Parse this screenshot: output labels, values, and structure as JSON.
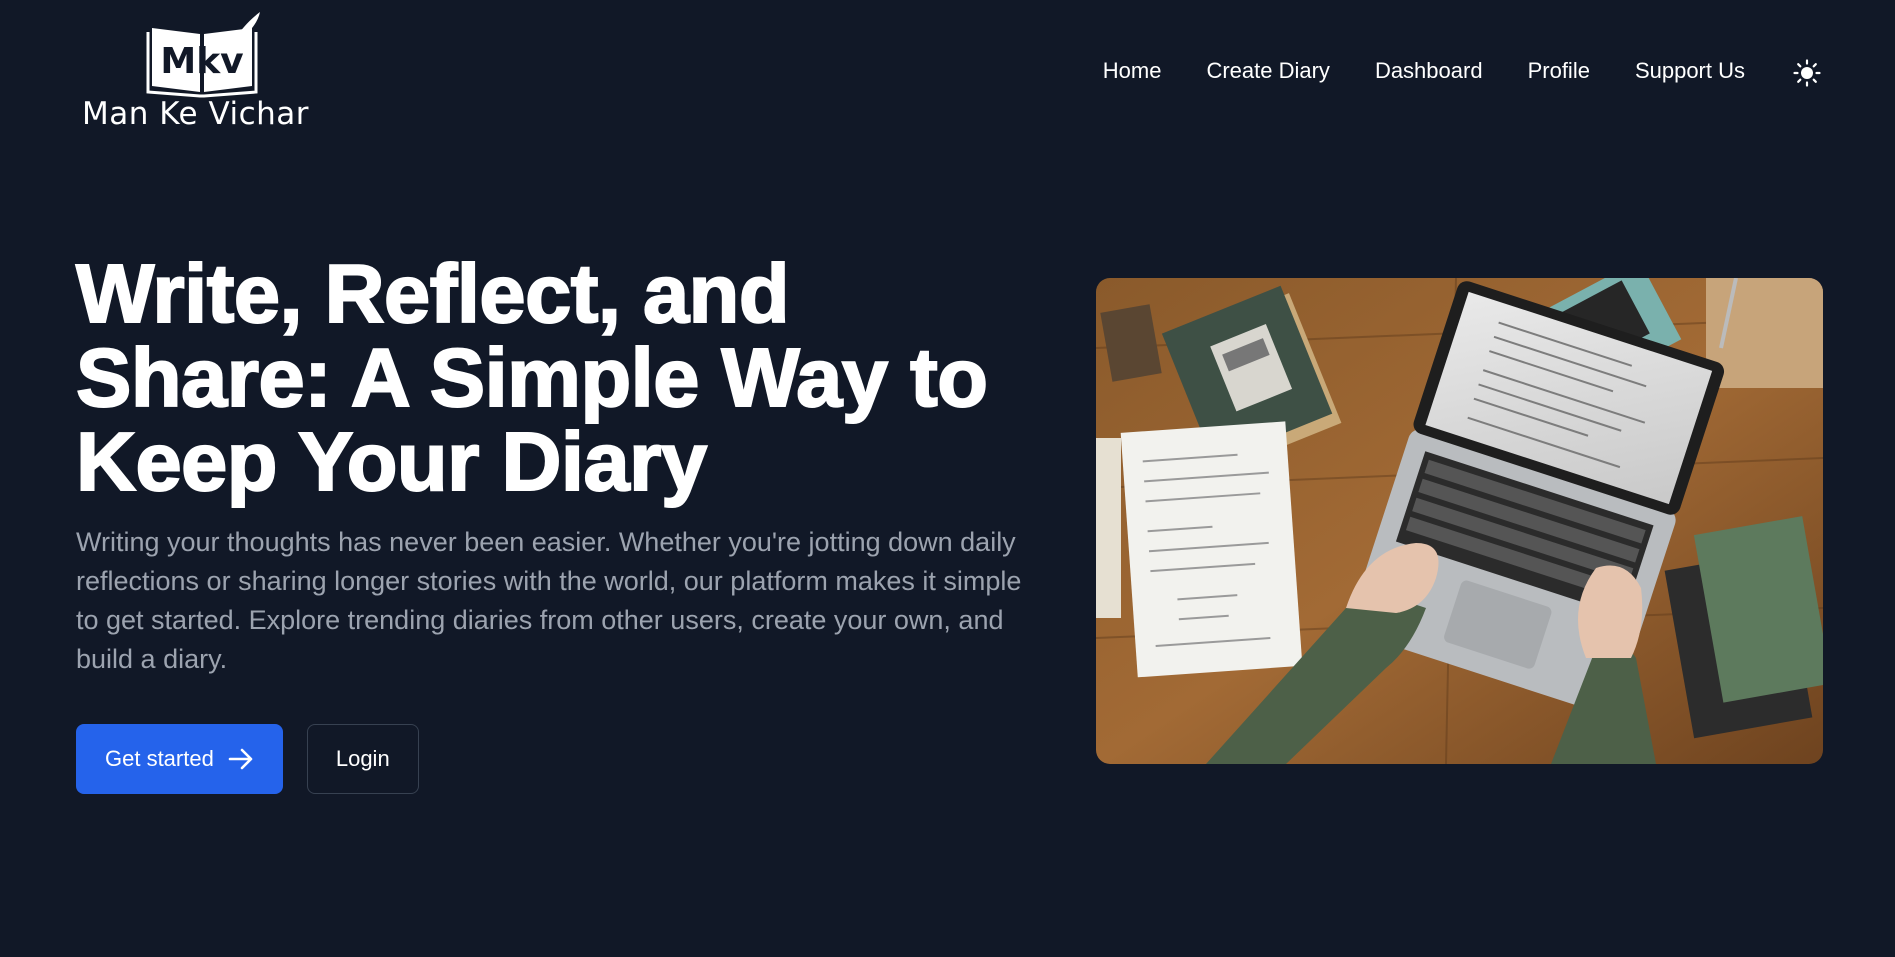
{
  "brand": {
    "logo_initials": "Mkv",
    "name": "Man Ke Vichar",
    "icon": "book-quill-logo-icon"
  },
  "nav": {
    "items": [
      {
        "label": "Home"
      },
      {
        "label": "Create Diary"
      },
      {
        "label": "Dashboard"
      },
      {
        "label": "Profile"
      },
      {
        "label": "Support Us"
      }
    ],
    "theme_toggle_icon": "sun-icon"
  },
  "hero": {
    "title": "Write, Reflect, and Share: A Simple Way to Keep Your Diary",
    "description": "Writing your thoughts has never been easier. Whether you're jotting down daily reflections or sharing longer stories with the world, our platform makes it simple to get started. Explore trending diaries from other users, create your own, and build a diary.",
    "primary_button": {
      "label": "Get started",
      "icon": "arrow-right-icon"
    },
    "secondary_button": {
      "label": "Login"
    },
    "image": "laptop-writing-desk-photo"
  },
  "colors": {
    "background": "#111827",
    "accent": "#2563eb",
    "text_primary": "#ffffff",
    "text_muted": "#9ca3af",
    "border": "#374151"
  }
}
